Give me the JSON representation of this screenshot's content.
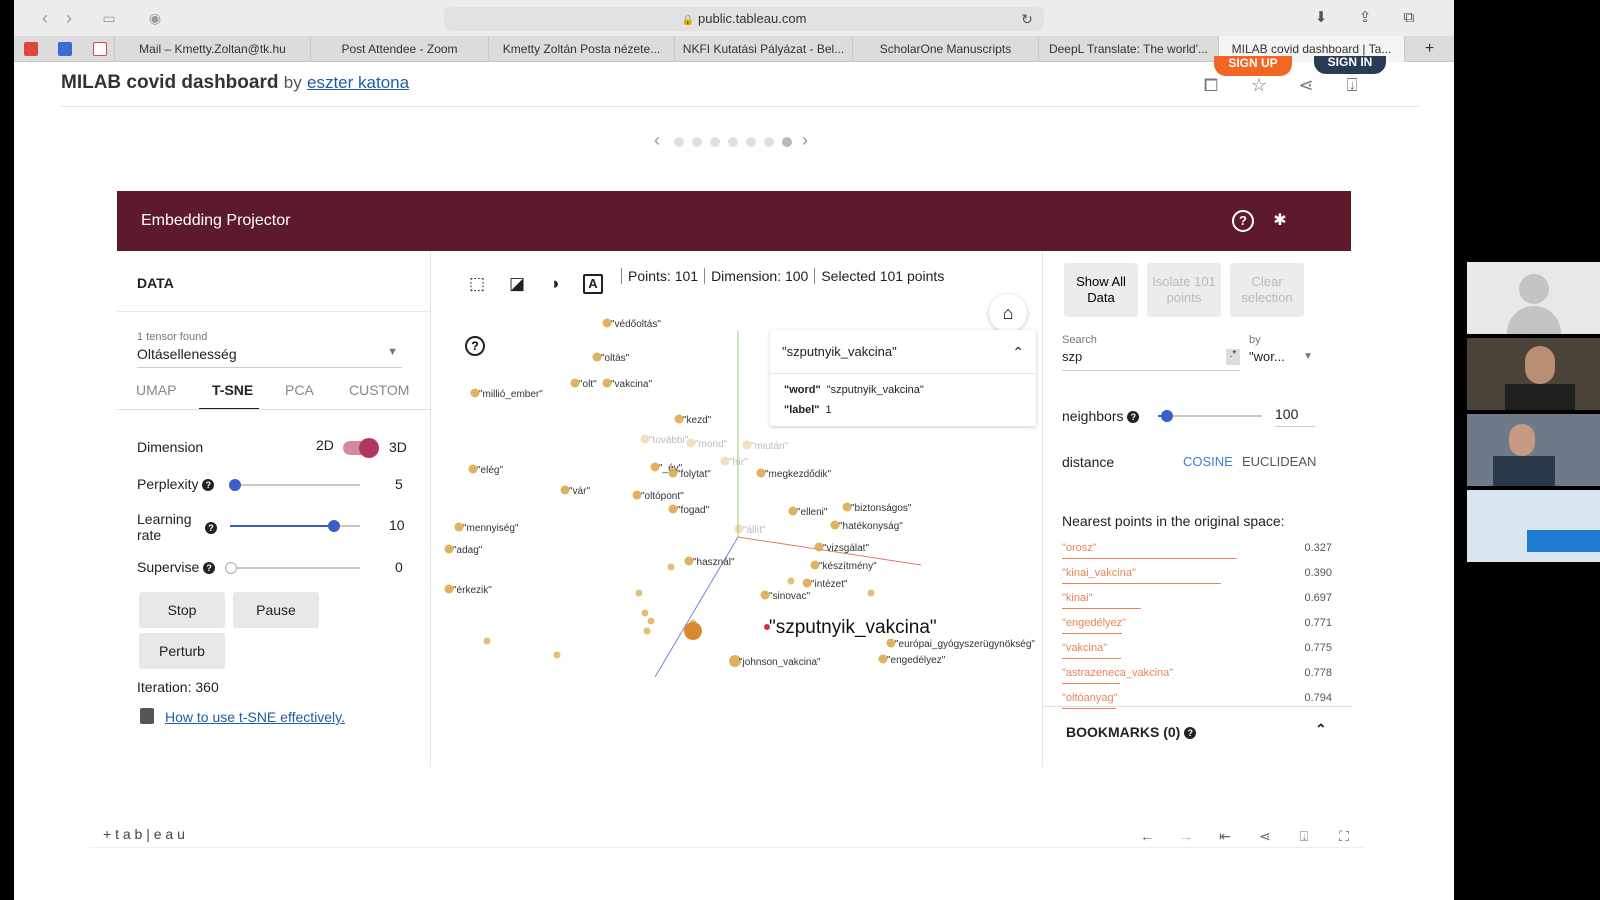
{
  "browser": {
    "url": "public.tableau.com",
    "tabs": [
      {
        "label": "Mail – Kmetty.Zoltan@tk.hu"
      },
      {
        "label": "Post Attendee - Zoom"
      },
      {
        "label": "Kmetty Zoltán Posta nézete..."
      },
      {
        "label": "NKFI Kutatási Pályázat - Bel..."
      },
      {
        "label": "ScholarOne Manuscripts"
      },
      {
        "label": "DeepL Translate: The world'..."
      },
      {
        "label": "MILAB covid dashboard | Ta..."
      }
    ],
    "new_tab": "+"
  },
  "header": {
    "title": "MILAB covid dashboard",
    "by": "by",
    "author": "eszter katona",
    "signup": "SIGN UP",
    "signin": "SIGN IN"
  },
  "projector": {
    "title": "Embedding Projector",
    "data_label": "DATA",
    "tensor_found": "1 tensor found",
    "tensor_name": "Oltásellenesség",
    "methods": [
      {
        "label": "UMAP"
      },
      {
        "label": "T-SNE"
      },
      {
        "label": "PCA"
      },
      {
        "label": "CUSTOM"
      }
    ],
    "dimension_label": "Dimension",
    "dim_2d": "2D",
    "dim_3d": "3D",
    "perplexity_label": "Perplexity",
    "perplexity_value": "5",
    "perplexity_fraction": 0.04,
    "learning_rate_label": "Learning rate",
    "learning_rate_value": "10",
    "learning_rate_fraction": 0.8,
    "supervise_label": "Supervise",
    "supervise_value": "0",
    "stop": "Stop",
    "pause": "Pause",
    "perturb": "Perturb",
    "iteration": "Iteration: 360",
    "howto_link": "How to use t-SNE effectively.",
    "points": "Points: 101",
    "dimension": "Dimension: 100",
    "selected": "Selected 101 points",
    "popup_title": "\"szputnyik_vakcina\"",
    "popup_word_key": "\"word\"",
    "popup_word_val": "\"szputnyik_vakcina\"",
    "popup_label_key": "\"label\"",
    "popup_label_val": "1",
    "big_label": "\"szputnyik_vakcina\"",
    "scatter_labels": [
      "\"védőoltás\"",
      "\"oltás\"",
      "\"olt\"",
      "\"vakcina\"",
      "\"millió_ember\"",
      "\"kezd\"",
      "\"további\"",
      "\"mond\"",
      "\"miután\"",
      "\"hír\"",
      "\"_év\"",
      "\"folytat\"",
      "\"megkezdődik\"",
      "\"elég\"",
      "\"vár\"",
      "\"oltópont\"",
      "\"fogad\"",
      "\"elleni\"",
      "\"biztonságos\"",
      "\"hatékonyság\"",
      "\"mennyiség\"",
      "\"adag\"",
      "\"állít\"",
      "\"vizsgálat\"",
      "\"használ\"",
      "\"készítmény\"",
      "\"intézet\"",
      "\"érkezik\"",
      "\"sinovac\"",
      "\"európai_gyógyszerügynökség\"",
      "\"engedélyez\"",
      "\"johnson_vakcina\""
    ],
    "show_all": "Show All Data",
    "isolate": "Isolate 101 points",
    "clear": "Clear selection",
    "search_label": "Search",
    "search_value": "szp",
    "by_label": "by",
    "by_value": "\"wor...",
    "neighbors_label": "neighbors",
    "neighbors_value": "100",
    "distance_label": "distance",
    "cosine": "COSINE",
    "euclidean": "EUCLIDEAN",
    "nearest_title": "Nearest points in the original space:",
    "nearest": [
      {
        "word": "\"orosz\"",
        "value": "0.327"
      },
      {
        "word": "\"kinai_vakcina\"",
        "value": "0.390"
      },
      {
        "word": "\"kinai\"",
        "value": "0.697"
      },
      {
        "word": "\"engedélyez\"",
        "value": "0.771"
      },
      {
        "word": "\"vakcina\"",
        "value": "0.775"
      },
      {
        "word": "\"astrazeneca_vakcina\"",
        "value": "0.778"
      },
      {
        "word": "\"oltóanyag\"",
        "value": "0.794"
      }
    ],
    "bookmarks": "BOOKMARKS (0)"
  },
  "footer": {
    "logo": "+ t a b | e a u"
  },
  "colors": {
    "header_bg": "#5c1a2a",
    "accent": "#3b5ec6",
    "point": "#d9a441",
    "neighbor": "#e8855a"
  }
}
